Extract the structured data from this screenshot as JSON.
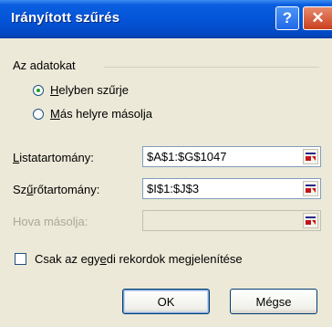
{
  "dialog": {
    "title": "Irányított szűrés",
    "help_label": "?",
    "close_label": "✕"
  },
  "action_group": {
    "label": "Az adatokat",
    "options": [
      {
        "pre": "",
        "key": "H",
        "post": "elyben szűrje",
        "selected": true
      },
      {
        "pre": "",
        "key": "M",
        "post": "ás helyre másolja",
        "selected": false
      }
    ]
  },
  "fields": {
    "list_range": {
      "pre": "",
      "key": "L",
      "post": "istatartomány:",
      "value": "$A$1:$G$1047"
    },
    "criteria_range": {
      "pre": "Sz",
      "key": "ű",
      "post": "rőtartomány:",
      "value": "$I$1:$J$3"
    },
    "copy_to": {
      "label": "Hova másolja:",
      "value": ""
    }
  },
  "unique_records": {
    "pre": "Csak az egy",
    "key": "e",
    "post": "di rekordok megjelenítése",
    "checked": false
  },
  "buttons": {
    "ok": "OK",
    "cancel": "Mégse"
  },
  "icons": {
    "collapse": "range-collapse-icon",
    "help": "help-icon",
    "close": "close-icon"
  }
}
